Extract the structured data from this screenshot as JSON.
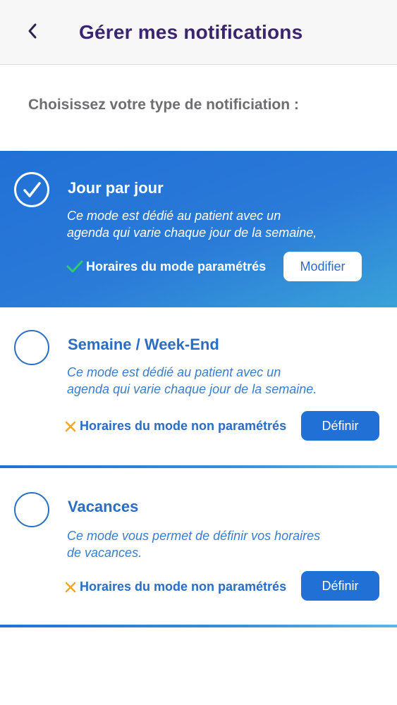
{
  "header": {
    "title": "Gérer mes notifications",
    "back_icon": "chevron-left-icon"
  },
  "prompt": "Choisissez votre type de notificiation :",
  "colors": {
    "title": "#3b2470",
    "primary_blue": "#2170d6",
    "check_green": "#2ecc71",
    "cross_orange": "#f5a623",
    "prompt_gray": "#6e6e72"
  },
  "modes": [
    {
      "title": "Jour par jour",
      "selected": true,
      "description_line1": "Ce mode est dédié au patient avec un",
      "description_line2": "agenda qui varie chaque jour de la semaine,",
      "status_icon": "check-icon",
      "status": "Horaires du mode paramétrés",
      "button": "Modifier"
    },
    {
      "title": "Semaine / Week-End",
      "selected": false,
      "description_line1": "Ce mode est dédié au patient avec un",
      "description_line2": "agenda qui varie chaque jour de la semaine.",
      "status_icon": "cross-icon",
      "status": "Horaires du mode non paramétrés",
      "button": "Définir"
    },
    {
      "title": "Vacances",
      "selected": false,
      "description_line1": "Ce mode vous permet de définir vos horaires",
      "description_line2": "de vacances.",
      "status_icon": "cross-icon",
      "status": "Horaires du mode non paramétrés",
      "button": "Définir"
    }
  ]
}
